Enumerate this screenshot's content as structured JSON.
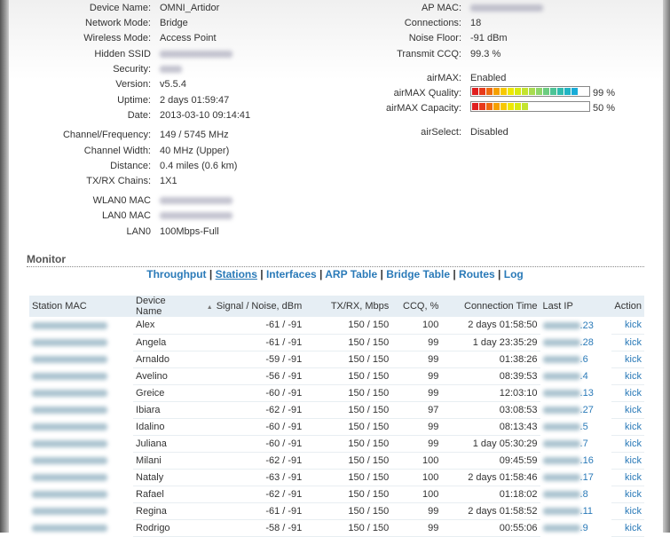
{
  "left_info": [
    {
      "label": "Device Name:",
      "value": "OMNI_Artidor"
    },
    {
      "label": "Network Mode:",
      "value": "Bridge"
    },
    {
      "label": "Wireless Mode:",
      "value": "Access Point"
    },
    {
      "label": "Hidden SSID",
      "value": null,
      "blurred": true
    },
    {
      "label": "Security:",
      "value": null,
      "blurred": true
    },
    {
      "label": "Version:",
      "value": "v5.5.4"
    },
    {
      "label": "Uptime:",
      "value": "2 days 01:59:47"
    },
    {
      "label": "Date:",
      "value": "2013-03-10 09:14:41"
    },
    {
      "label": "Channel/Frequency:",
      "value": "149 / 5745 MHz"
    },
    {
      "label": "Channel Width:",
      "value": "40 MHz (Upper)"
    },
    {
      "label": "Distance:",
      "value": "0.4 miles (0.6 km)"
    },
    {
      "label": "TX/RX Chains:",
      "value": "1X1"
    },
    {
      "label": "WLAN0 MAC",
      "value": null,
      "blurred": true
    },
    {
      "label": "LAN0 MAC",
      "value": null,
      "blurred": true
    },
    {
      "label": "LAN0",
      "value": "100Mbps-Full"
    }
  ],
  "right_info": {
    "ap_mac_label": "AP MAC:",
    "connections_label": "Connections:",
    "connections": "18",
    "noise_label": "Noise Floor:",
    "noise": "-91 dBm",
    "ccq_label": "Transmit CCQ:",
    "ccq": "99.3 %",
    "airmax_label": "airMAX:",
    "airmax": "Enabled",
    "quality_label": "airMAX Quality:",
    "quality_pct": "99 %",
    "quality_value": 99,
    "capacity_label": "airMAX Capacity:",
    "capacity_pct": "50 %",
    "capacity_value": 50,
    "airselect_label": "airSelect:",
    "airselect": "Disabled"
  },
  "monitor": {
    "title": "Monitor",
    "tabs": [
      "Throughput",
      "Stations",
      "Interfaces",
      "ARP Table",
      "Bridge Table",
      "Routes",
      "Log"
    ],
    "active_tab": "Stations"
  },
  "table": {
    "headers": [
      "Station MAC",
      "Device Name",
      "Signal / Noise, dBm",
      "TX/RX, Mbps",
      "CCQ, %",
      "Connection Time",
      "Last IP",
      "Action"
    ],
    "rows": [
      [
        "Alex",
        "-61 / -91",
        "150 / 150",
        "100",
        "2 days 01:58:50",
        ".23",
        "kick"
      ],
      [
        "Angela",
        "-61 / -91",
        "150 / 150",
        "99",
        "1 day 23:35:29",
        ".28",
        "kick"
      ],
      [
        "Arnaldo",
        "-59 / -91",
        "150 / 150",
        "99",
        "01:38:26",
        ".6",
        "kick"
      ],
      [
        "Avelino",
        "-56 / -91",
        "150 / 150",
        "99",
        "08:39:53",
        ".4",
        "kick"
      ],
      [
        "Greice",
        "-60 / -91",
        "150 / 150",
        "99",
        "12:03:10",
        ".13",
        "kick"
      ],
      [
        "Ibiara",
        "-62 / -91",
        "150 / 150",
        "97",
        "03:08:53",
        ".27",
        "kick"
      ],
      [
        "Idalino",
        "-60 / -91",
        "150 / 150",
        "99",
        "08:13:43",
        ".5",
        "kick"
      ],
      [
        "Juliana",
        "-60 / -91",
        "150 / 150",
        "99",
        "1 day 05:30:29",
        ".7",
        "kick"
      ],
      [
        "Milani",
        "-62 / -91",
        "150 / 150",
        "100",
        "09:45:59",
        ".16",
        "kick"
      ],
      [
        "Nataly",
        "-63 / -91",
        "150 / 150",
        "100",
        "2 days 01:58:46",
        ".17",
        "kick"
      ],
      [
        "Rafael",
        "-62 / -91",
        "150 / 150",
        "100",
        "01:18:02",
        ".8",
        "kick"
      ],
      [
        "Regina",
        "-61 / -91",
        "150 / 150",
        "99",
        "2 days 01:58:52",
        ".11",
        "kick"
      ],
      [
        "Rodrigo",
        "-58 / -91",
        "150 / 150",
        "99",
        "00:55:06",
        ".9",
        "kick"
      ]
    ]
  },
  "colors": {
    "link": "#2a7ab8",
    "header_bg": "#e6eef4"
  }
}
